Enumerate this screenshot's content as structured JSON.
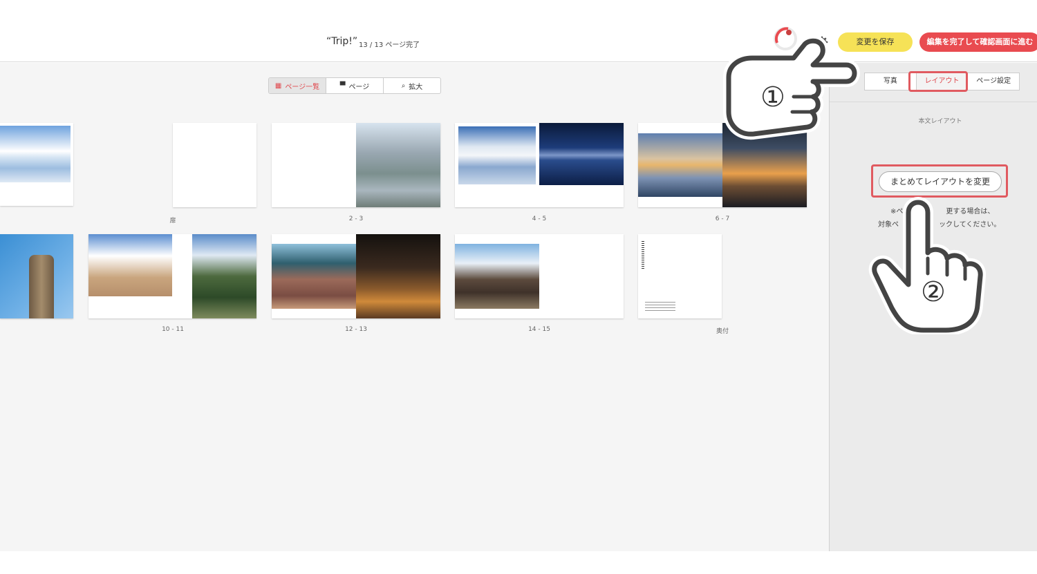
{
  "header": {
    "title": "“Trip!”",
    "pages_status": "13 / 13 ページ完了",
    "save_label": "変更を保存",
    "finish_label": "編集を完了して確認画面に進む"
  },
  "view_toggle": {
    "items": [
      {
        "label": "ページ一覧",
        "icon": "grid-icon"
      },
      {
        "label": "ページ",
        "icon": "book-icon"
      },
      {
        "label": "拡大",
        "icon": "magnifier-icon"
      }
    ]
  },
  "spreads": [
    {
      "label": "扉"
    },
    {
      "label": "2 - 3"
    },
    {
      "label": "4 - 5"
    },
    {
      "label": "6 - 7"
    },
    {
      "label": "10 - 11"
    },
    {
      "label": "12 - 13"
    },
    {
      "label": "14 - 15"
    },
    {
      "label": "奥付"
    }
  ],
  "sidebar": {
    "tabs": [
      {
        "label": "写真"
      },
      {
        "label": "レイアウト"
      },
      {
        "label": "ページ設定"
      }
    ],
    "heading": "本文レイアウト",
    "bulk_button": "まとめてレイアウトを変更",
    "note_line1_a": "※ペ",
    "note_line1_b": "更する場合は、",
    "note_line2_a": "対象ペ",
    "note_line2_b": "ックしてください。"
  },
  "callouts": {
    "step1": "①",
    "step2": "②"
  },
  "colors": {
    "accent_red": "#e94b50",
    "save_yellow": "#f6e257",
    "highlight": "#e05a60"
  }
}
